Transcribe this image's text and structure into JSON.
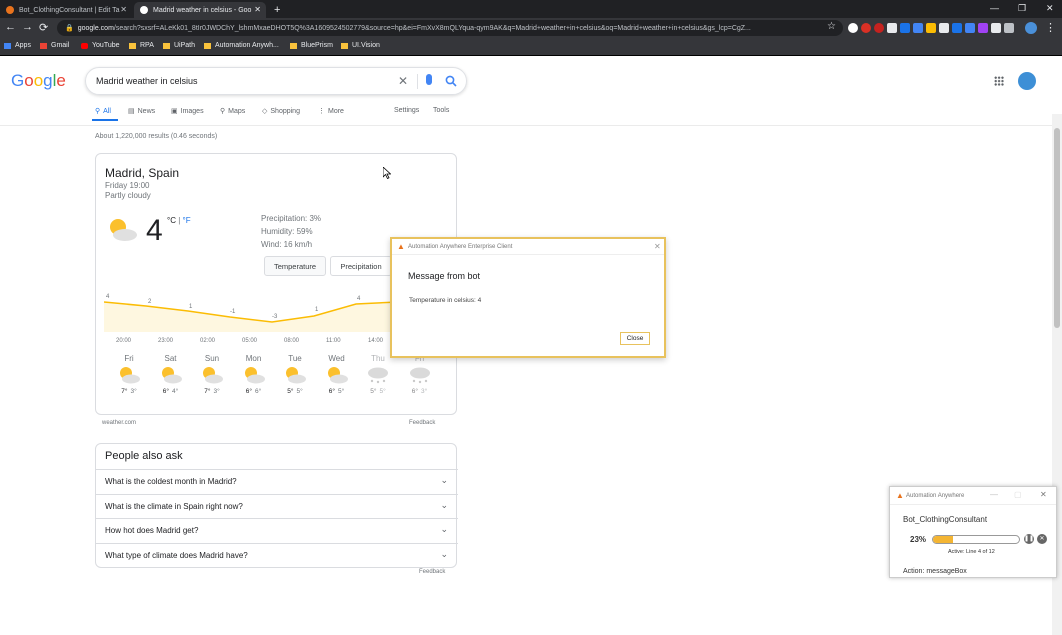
{
  "browser": {
    "tabs": [
      {
        "title": "Bot_ClothingConsultant | Edit Ta",
        "favicon_color": "#e8731d"
      },
      {
        "title": "Madrid weather in celsius - Goo",
        "favicon_color": "#ffffff"
      }
    ],
    "new_tab": "+",
    "url_domain": "google.com",
    "url_rest": "/search?sxsrf=ALeKk01_8tIr0JWDChY_lshmMxaeDHOT5Q%3A1609524502779&source=hp&ei=FmXvX8mQLYqua-qym9AK&q=Madrid+weather+in+celsius&oq=Madrid+weather+in+celsius&gs_lcp=CgZ...",
    "bookmarks": [
      {
        "label": "Apps",
        "color": "#4285f4"
      },
      {
        "label": "Gmail",
        "color": "#ea4335"
      },
      {
        "label": "YouTube",
        "color": "#ff0000"
      },
      {
        "label": "RPA",
        "color": "#f9c23c"
      },
      {
        "label": "UiPath",
        "color": "#f9c23c"
      },
      {
        "label": "Automation Anywh...",
        "color": "#f9c23c"
      },
      {
        "label": "BluePrism",
        "color": "#f9c23c"
      },
      {
        "label": "UI.Vision",
        "color": "#f9c23c"
      }
    ],
    "extension_colors": [
      "#ffffff",
      "#d93025",
      "#c5221f",
      "#e8eaed",
      "#1a73e8",
      "#4285f4",
      "#fbbc04",
      "#e8eaed",
      "#1a73e8",
      "#4285f4",
      "#a142f4",
      "#e8eaed",
      "#bdc1c6"
    ]
  },
  "google": {
    "logo": "Google",
    "query": "Madrid weather in celsius",
    "tabs": [
      {
        "label": "All",
        "icon": "search-icon"
      },
      {
        "label": "News",
        "icon": "news-icon"
      },
      {
        "label": "Images",
        "icon": "image-icon"
      },
      {
        "label": "Maps",
        "icon": "map-pin-icon"
      },
      {
        "label": "Shopping",
        "icon": "tag-icon"
      },
      {
        "label": "More",
        "icon": "more-vert-icon"
      }
    ],
    "settings": "Settings",
    "tools": "Tools",
    "result_stats": "About 1,220,000 results (0.46 seconds)"
  },
  "weather": {
    "location": "Madrid, Spain",
    "time": "Friday 19:00",
    "condition": "Partly cloudy",
    "temp": "4",
    "unit_c": "°C",
    "unit_sep": " | ",
    "unit_f": "°F",
    "precipitation": "Precipitation: 3%",
    "humidity": "Humidity: 59%",
    "wind": "Wind: 16 km/h",
    "btn_temperature": "Temperature",
    "btn_precipitation": "Precipitation",
    "chart_values": [
      "4",
      "2",
      "1",
      "-1",
      "-3",
      "1",
      "4"
    ],
    "chart_times": [
      "20:00",
      "23:00",
      "02:00",
      "05:00",
      "08:00",
      "11:00",
      "14:00"
    ],
    "days": [
      {
        "day": "Fri",
        "hi": "7°",
        "lo": "3°",
        "icon": "partly-cloudy-icon"
      },
      {
        "day": "Sat",
        "hi": "6°",
        "lo": "4°",
        "icon": "partly-cloudy-icon"
      },
      {
        "day": "Sun",
        "hi": "7°",
        "lo": "3°",
        "icon": "partly-cloudy-icon"
      },
      {
        "day": "Mon",
        "hi": "6°",
        "lo": "6°",
        "icon": "partly-cloudy-icon"
      },
      {
        "day": "Tue",
        "hi": "5°",
        "lo": "5°",
        "icon": "partly-cloudy-icon"
      },
      {
        "day": "Wed",
        "hi": "6°",
        "lo": "5°",
        "icon": "partly-cloudy-icon"
      },
      {
        "day": "Thu",
        "hi": "5°",
        "lo": "5°",
        "icon": "snow-icon"
      },
      {
        "day": "Fri",
        "hi": "6°",
        "lo": "3°",
        "icon": "snow-icon"
      }
    ],
    "source": "weather.com",
    "feedback": "Feedback"
  },
  "paa": {
    "title": "People also ask",
    "questions": [
      "What is the coldest month in Madrid?",
      "What is the climate in Spain right now?",
      "How hot does Madrid get?",
      "What type of climate does Madrid have?"
    ],
    "feedback": "Feedback"
  },
  "dialog": {
    "title": "Automation Anywhere Enterprise Client",
    "heading": "Message from bot",
    "message": "Temperature in celsius: 4",
    "close": "Close"
  },
  "aa_panel": {
    "title": "Automation Anywhere",
    "bot_name": "Bot_ClothingConsultant",
    "progress": 0.23,
    "progress_label": "23%",
    "status": "Active: Line 4 of 12",
    "action": "Action: messageBox"
  }
}
